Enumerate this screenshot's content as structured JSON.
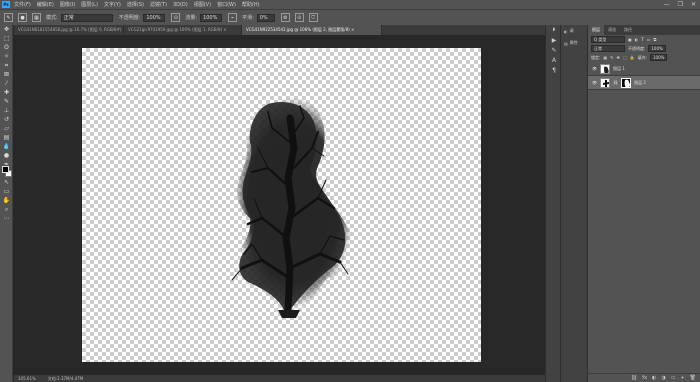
{
  "app": {
    "logo": "Ps"
  },
  "menu": [
    "文件(F)",
    "编辑(E)",
    "图像(I)",
    "图层(L)",
    "文字(Y)",
    "选择(S)",
    "滤镜(T)",
    "3D(D)",
    "视图(V)",
    "窗口(W)",
    "帮助(H)"
  ],
  "window_controls": [
    "—",
    "❐",
    "✕"
  ],
  "options": {
    "mode_label": "模式:",
    "mode_value": "正常",
    "opacity_label": "不透明度:",
    "opacity_value": "100%",
    "flow_label": "流量:",
    "flow_value": "100%",
    "smooth_label": "平滑:",
    "smooth_value": "0%"
  },
  "tabs": [
    "VCG41N6181554858.jpg @ 16.7% (图层 0, RGB/8#) ×",
    "VCG21gic9741959.jpg @ 100% (图层 1, RGB/8) ×",
    "VCG41N922534542.jpg @ 106% (图层 2, 图层蒙版/8) ×"
  ],
  "status": {
    "zoom": "105.61%",
    "doc": "文档:2.37M/4.47M"
  },
  "properties": {
    "label": "属性",
    "icon_label": "调"
  },
  "layers_panel": {
    "tabs": [
      "图层",
      "通道",
      "路径"
    ],
    "kind_label": "Q 类型",
    "blend_mode": "正常",
    "opacity_label": "不透明度:",
    "opacity_value": "100%",
    "lock_label": "锁定:",
    "fill_label": "填充:",
    "fill_value": "100%",
    "layers": [
      {
        "name": "图层 1",
        "selected": false
      },
      {
        "name": "图层 2",
        "selected": true
      }
    ],
    "bottom_icons": [
      "⛓",
      "fx",
      "◐",
      "◑",
      "▭",
      "+",
      "🗑"
    ]
  }
}
